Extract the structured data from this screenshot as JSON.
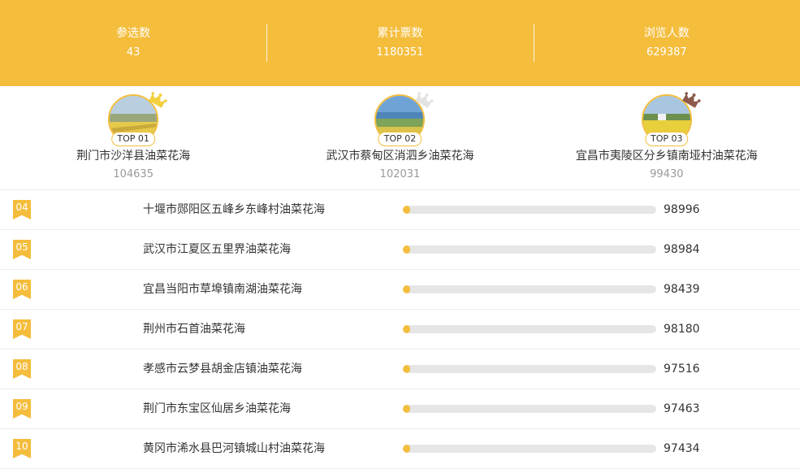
{
  "stats": [
    {
      "label": "参选数",
      "value": "43"
    },
    {
      "label": "累计票数",
      "value": "1180351"
    },
    {
      "label": "浏览人数",
      "value": "629387"
    }
  ],
  "top3": [
    {
      "badge": "TOP 01",
      "name": "荆门市沙洋县油菜花海",
      "score": "104635",
      "crown_color": "#f4d03f",
      "crown_icon": "crown-gold-icon"
    },
    {
      "badge": "TOP 02",
      "name": "武汉市蔡甸区消泗乡油菜花海",
      "score": "102031",
      "crown_color": "#e3e3e3",
      "crown_icon": "crown-silver-icon"
    },
    {
      "badge": "TOP 03",
      "name": "宜昌市夷陵区分乡镇南垭村油菜花海",
      "score": "99430",
      "crown_color": "#8d5a4a",
      "crown_icon": "crown-bronze-icon"
    }
  ],
  "rows": [
    {
      "rank": "04",
      "name": "十堰市郧阳区五峰乡东峰村油菜花海",
      "value": "98996",
      "progress": 0.03
    },
    {
      "rank": "05",
      "name": "武汉市江夏区五里界油菜花海",
      "value": "98984",
      "progress": 0.03
    },
    {
      "rank": "06",
      "name": "宜昌当阳市草埠镇南湖油菜花海",
      "value": "98439",
      "progress": 0.03
    },
    {
      "rank": "07",
      "name": "荆州市石首油菜花海",
      "value": "98180",
      "progress": 0.03
    },
    {
      "rank": "08",
      "name": "孝感市云梦县胡金店镇油菜花海",
      "value": "97516",
      "progress": 0.03
    },
    {
      "rank": "09",
      "name": "荆门市东宝区仙居乡油菜花海",
      "value": "97463",
      "progress": 0.03
    },
    {
      "rank": "10",
      "name": "黄冈市浠水县巴河镇城山村油菜花海",
      "value": "97434",
      "progress": 0.03
    }
  ],
  "colors": {
    "accent": "#f4bd3c",
    "track": "#e6e6e6"
  }
}
